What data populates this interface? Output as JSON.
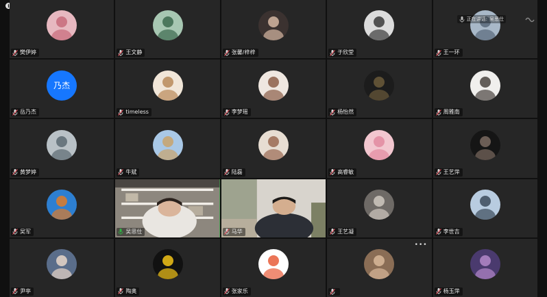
{
  "speaking_banner": {
    "label": "正在讲话:",
    "speaker": "吴思仕"
  },
  "participants": [
    {
      "name": "樊伊婷",
      "avatar": "photo-pink-doll",
      "bg": "#e7b8c0",
      "fg": "#c76a7a"
    },
    {
      "name": "王文静",
      "avatar": "photo-girl-field",
      "bg": "#a7c7b2",
      "fg": "#3c6a4e"
    },
    {
      "name": "张馨/梓梓",
      "avatar": "photo-girl-portrait",
      "bg": "#3b3230",
      "fg": "#d6b7a2"
    },
    {
      "name": "于欣堂",
      "avatar": "photo-girl-bw",
      "bg": "#dcdcdc",
      "fg": "#3a3a3a"
    },
    {
      "name": "王一环",
      "avatar": "photo-landscape",
      "bg": "#a8b8c8",
      "fg": "#59687a"
    },
    {
      "name": "岳乃杰",
      "avatar": "text-avatar",
      "bg": "#1677ff",
      "fg": "#ffffff",
      "initials": "乃杰"
    },
    {
      "name": "timeless",
      "avatar": "photo-cartoon-astronaut",
      "bg": "#f1e6d8",
      "fg": "#b9895a"
    },
    {
      "name": "李梦瑶",
      "avatar": "photo-painting-girl",
      "bg": "#efe7e0",
      "fg": "#8c5e48"
    },
    {
      "name": "杨怡然",
      "avatar": "photo-dark-figure",
      "bg": "#1c1c1c",
      "fg": "#6b5a3a"
    },
    {
      "name": "周雅南",
      "avatar": "photo-girl-white",
      "bg": "#f0efed",
      "fg": "#4a4440"
    },
    {
      "name": "黄梦婷",
      "avatar": "photo-flowers",
      "bg": "#b9c1c6",
      "fg": "#5c6a72"
    },
    {
      "name": "牛斌",
      "avatar": "photo-beach-person",
      "bg": "#a9c8e6",
      "fg": "#c9a36b"
    },
    {
      "name": "陆磊",
      "avatar": "photo-cat-crown",
      "bg": "#e7ddd2",
      "fg": "#9a6a52"
    },
    {
      "name": "高睿敏",
      "avatar": "photo-patrick-star",
      "bg": "#f2c6cf",
      "fg": "#e28aa0"
    },
    {
      "name": "王艺萍",
      "avatar": "photo-woman-dark",
      "bg": "#151515",
      "fg": "#7a6a60"
    },
    {
      "name": "吴军",
      "avatar": "photo-autumn-tree",
      "bg": "#2d7fd1",
      "fg": "#e07b28"
    },
    {
      "name": "吴思仕",
      "avatar": "video-woman",
      "bg": "#8b8378",
      "fg": "#d7cfc4",
      "speaking": true
    },
    {
      "name": "马华",
      "avatar": "video-man",
      "bg": "#c9c6c0",
      "fg": "#2b2b2b"
    },
    {
      "name": "王艺凝",
      "avatar": "photo-road-trip",
      "bg": "#6e6a66",
      "fg": "#cfc8bf"
    },
    {
      "name": "李世吉",
      "avatar": "photo-sky-person",
      "bg": "#b8cce0",
      "fg": "#3b4a5a"
    },
    {
      "name": "尹亭",
      "avatar": "photo-group-selfie",
      "bg": "#5a6d8a",
      "fg": "#e8d6c8"
    },
    {
      "name": "陶奥",
      "avatar": "photo-ginkgo-leaf",
      "bg": "#111111",
      "fg": "#f2c318"
    },
    {
      "name": "张家乐",
      "avatar": "photo-cartoon-bird",
      "bg": "#ffffff",
      "fg": "#e85d3a"
    },
    {
      "name": "",
      "avatar": "photo-brown-abstract",
      "bg": "#8a6d55",
      "fg": "#d8b89a"
    },
    {
      "name": "杨玉萍",
      "avatar": "photo-purple-sky",
      "bg": "#4a3a6e",
      "fg": "#b388c9"
    }
  ]
}
